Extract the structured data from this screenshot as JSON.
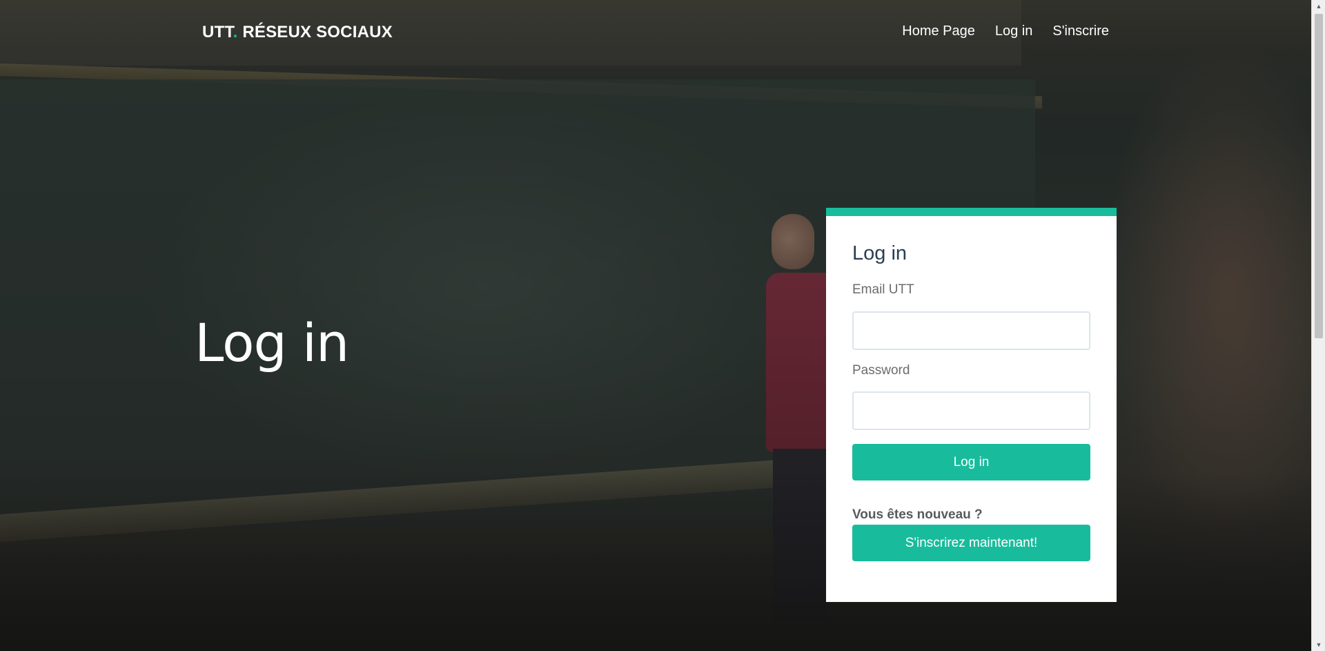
{
  "navbar": {
    "brand_part1": "UTT",
    "brand_dot": ".",
    "brand_part2": " RÉSEUX SOCIAUX",
    "links": [
      "Home Page",
      "Log in",
      "S'inscrire"
    ]
  },
  "hero": {
    "title": "Log in"
  },
  "login_card": {
    "title": "Log in",
    "email_label": "Email UTT",
    "email_value": "",
    "password_label": "Password",
    "password_value": "",
    "login_button": "Log in",
    "new_user_text": "Vous êtes nouveau ?",
    "signup_button": "S'inscrirez maintenant!"
  },
  "colors": {
    "accent": "#18bc9c",
    "card_bg": "#ffffff",
    "text_dark": "#2c3e50"
  },
  "icons": {
    "scroll_up": "scroll-up-arrow-icon",
    "scroll_down": "scroll-down-arrow-icon"
  }
}
